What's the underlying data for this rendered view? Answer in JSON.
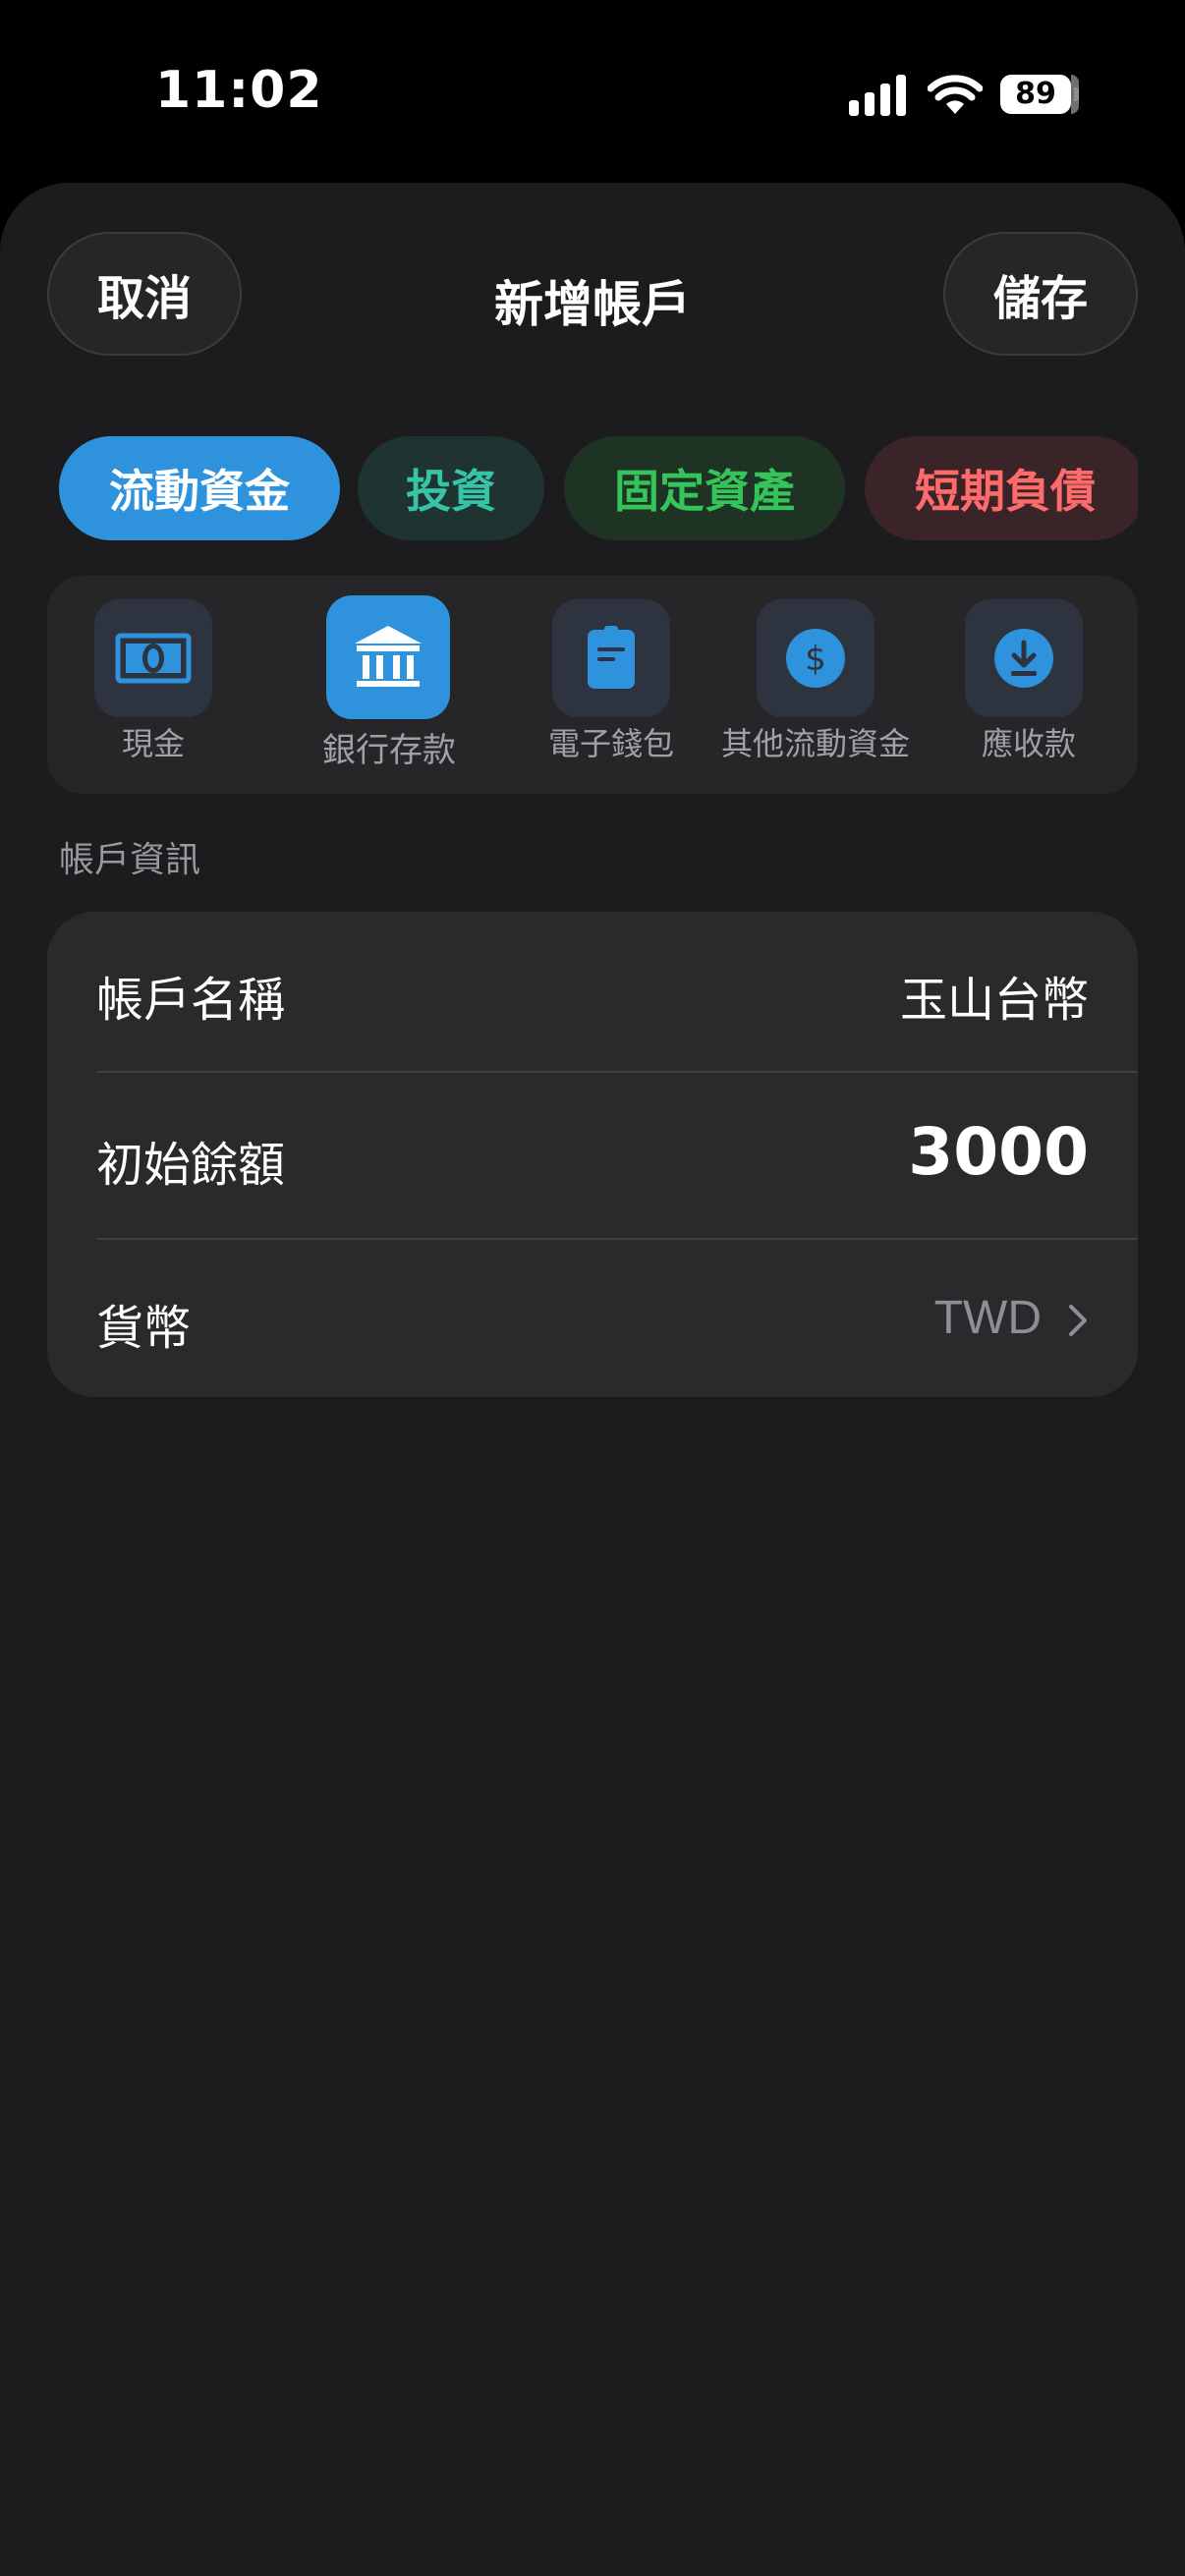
{
  "status": {
    "time": "11:02",
    "battery": "89"
  },
  "header": {
    "cancel_label": "取消",
    "title": "新增帳戶",
    "save_label": "儲存"
  },
  "tabs": [
    {
      "label": "流動資金",
      "active": true,
      "color": "#ffffff",
      "bg": "#2f92dc"
    },
    {
      "label": "投資",
      "active": false,
      "color": "#35c4a6",
      "bg": "#1f3330"
    },
    {
      "label": "固定資產",
      "active": false,
      "color": "#34c45a",
      "bg": "#1f3324"
    },
    {
      "label": "短期負債",
      "active": false,
      "color": "#ff6b6b",
      "bg": "#3a2427"
    }
  ],
  "account_types": [
    {
      "label": "現金",
      "icon": "cash-icon",
      "selected": false
    },
    {
      "label": "銀行存款",
      "icon": "bank-icon",
      "selected": true
    },
    {
      "label": "電子錢包",
      "icon": "wallet-icon",
      "selected": false
    },
    {
      "label": "其他流動資金",
      "icon": "dollar-icon",
      "selected": false
    },
    {
      "label": "應收款",
      "icon": "download-icon",
      "selected": false
    }
  ],
  "section": {
    "title": "帳戶資訊"
  },
  "form": {
    "name_label": "帳戶名稱",
    "name_value": "玉山台幣",
    "balance_label": "初始餘額",
    "balance_value": "3000",
    "currency_label": "貨幣",
    "currency_value": "TWD"
  },
  "colors": {
    "accent": "#2f92dc",
    "background": "#1c1c1e",
    "card": "#2a2a2d"
  }
}
